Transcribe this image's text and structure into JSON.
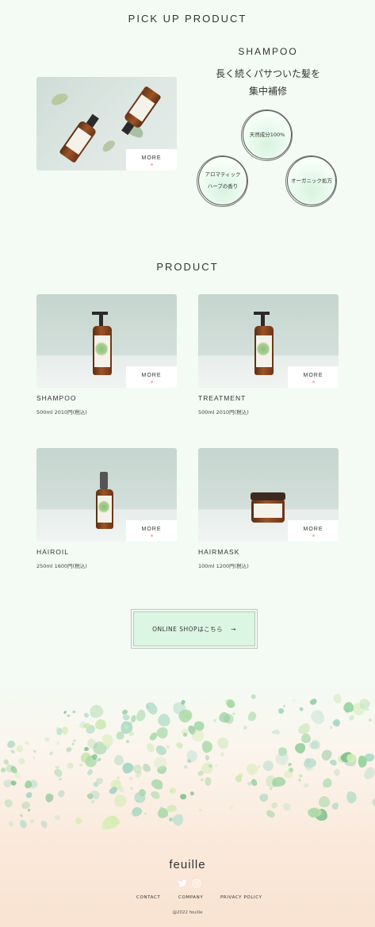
{
  "pickup": {
    "section_title": "PICK UP PRODUCT",
    "product_name": "SHAMPOO",
    "copy_line1": "長く続くパサついた髪を",
    "copy_line2": "集中補修",
    "more_label": "MORE",
    "features": [
      {
        "line1": "天然成分100%",
        "line2": ""
      },
      {
        "line1": "アロマティック",
        "line2": "ハーブの香り"
      },
      {
        "line1": "オーガニック処方",
        "line2": ""
      }
    ]
  },
  "products": {
    "section_title": "PRODUCT",
    "items": [
      {
        "name": "SHAMPOO",
        "price": "500ml 2010円(税込)",
        "more_label": "MORE"
      },
      {
        "name": "TREATMENT",
        "price": "500ml 2010円(税込)",
        "more_label": "MORE"
      },
      {
        "name": "HAIROIL",
        "price": "250ml 1600円(税込)",
        "more_label": "MORE"
      },
      {
        "name": "HAIRMASK",
        "price": "100ml 1200円(税込)",
        "more_label": "MORE"
      }
    ]
  },
  "shop_button": {
    "label": "ONLINE SHOPはこちら",
    "arrow": "→"
  },
  "footer": {
    "logo": "feuille",
    "social": [
      "twitter-icon",
      "instagram-icon"
    ],
    "links": [
      "CONTACT",
      "COMPANY",
      "PRIVACY POLICY"
    ],
    "copyright": "@2022 feuille"
  },
  "colors": {
    "background": "#f3fbf4",
    "button_bg": "#dbf6e2",
    "footer_peach": "#f9e3d2",
    "more_dot": "#f3b9b0"
  }
}
